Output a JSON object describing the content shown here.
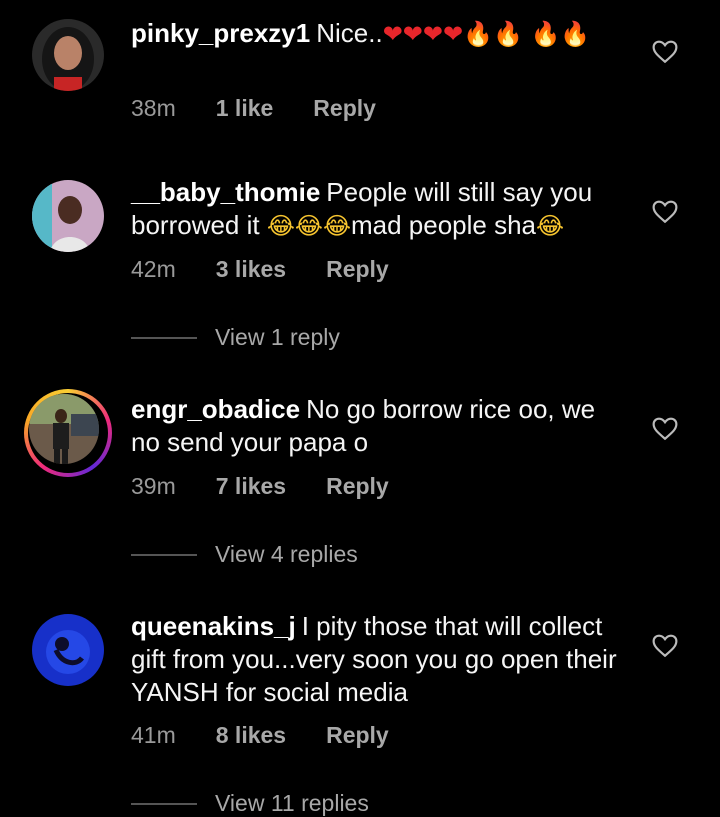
{
  "comments": [
    {
      "username": "pinky_prexzy1",
      "text": "Nice..",
      "time": "38m",
      "likes": "1 like",
      "reply": "Reply"
    },
    {
      "username": "__baby_thomie",
      "text": "People will still say you borrowed it",
      "text_tail": "mad people sha",
      "time": "42m",
      "likes": "3 likes",
      "reply": "Reply",
      "view_replies": "View 1 reply"
    },
    {
      "username": "engr_obadice",
      "text": "No go borrow rice oo, we no send your papa o",
      "time": "39m",
      "likes": "7 likes",
      "reply": "Reply",
      "view_replies": "View 4 replies"
    },
    {
      "username": "queenakins_j",
      "text": "I pity those that will collect gift from you...very soon you go open their YANSH for social media",
      "time": "41m",
      "likes": "8 likes",
      "reply": "Reply",
      "view_replies": "View 11 replies"
    }
  ],
  "icons": {
    "like": "heart-outline-icon",
    "red_heart": "red-heart-emoji",
    "fire": "fire-emoji",
    "laugh": "tears-of-joy-emoji"
  },
  "colors": {
    "background": "#000000",
    "text": "#f5f5f5",
    "secondary": "#9a9a9a",
    "divider": "#555555"
  }
}
